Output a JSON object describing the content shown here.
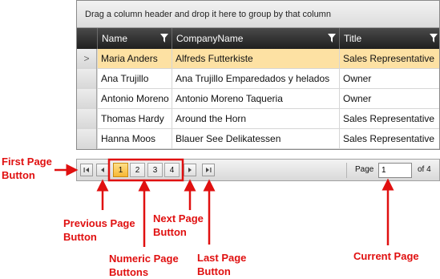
{
  "grid": {
    "group_panel_text": "Drag a column header and drop it here to group by that column",
    "columns": [
      "Name",
      "CompanyName",
      "Title"
    ],
    "rows": [
      {
        "name": "Maria Anders",
        "company": "Alfreds Futterkiste",
        "title": "Sales Representative",
        "selected": true
      },
      {
        "name": "Ana Trujillo",
        "company": "Ana Trujillo Emparedados y helados",
        "title": "Owner"
      },
      {
        "name": "Antonio Moreno",
        "company": "Antonio Moreno Taqueria",
        "title": "Owner"
      },
      {
        "name": "Thomas Hardy",
        "company": "Around the Horn",
        "title": "Sales Representative"
      },
      {
        "name": "Hanna Moos",
        "company": "Blauer See Delikatessen",
        "title": "Sales Representative"
      }
    ],
    "selected_indicator": ">"
  },
  "pager": {
    "pages": [
      "1",
      "2",
      "3",
      "4"
    ],
    "current_page": "1",
    "page_label": "Page",
    "of_label": "of 4"
  },
  "annotations": {
    "first_page_l1": "First Page",
    "first_page_l2": "Button",
    "previous_page_l1": "Previous Page",
    "previous_page_l2": "Button",
    "numeric_l1": "Numeric Page",
    "numeric_l2": "Buttons",
    "next_page_l1": "Next Page",
    "next_page_l2": "Button",
    "last_page_l1": "Last Page",
    "last_page_l2": "Button",
    "current_page": "Current Page"
  },
  "colors": {
    "annotation": "#e01010",
    "selected_row": "#fde1a3",
    "active_page": "#f7b734"
  }
}
